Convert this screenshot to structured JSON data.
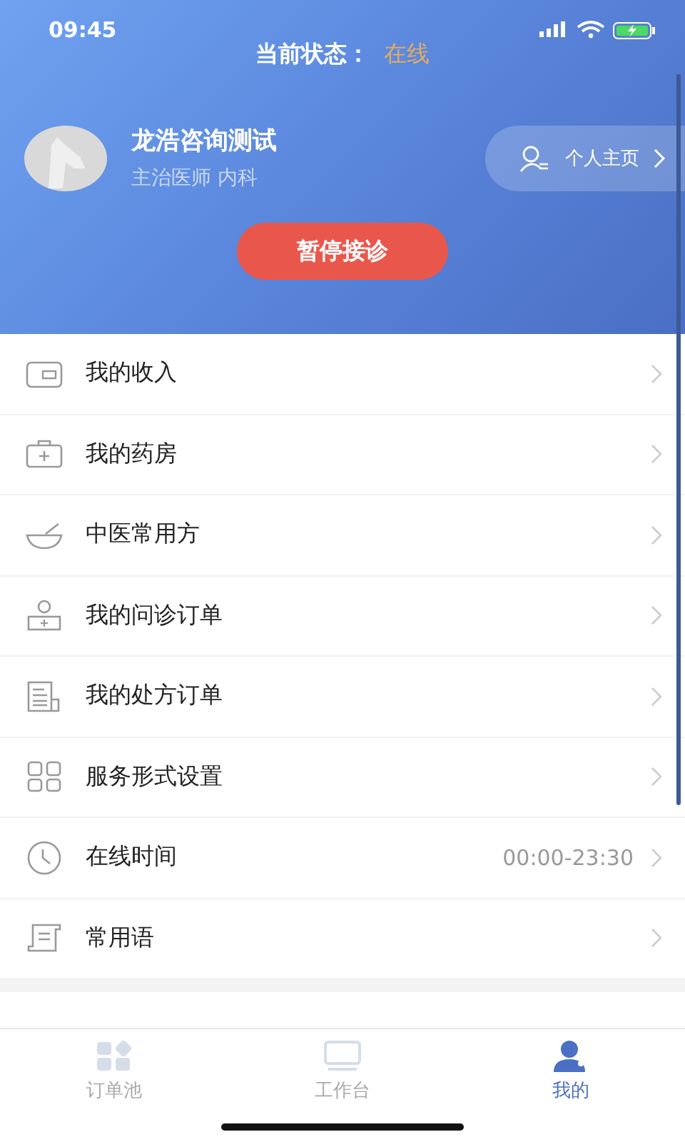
{
  "status_bar": {
    "time": "09:45"
  },
  "header": {
    "status_label": "当前状态：",
    "status_value": "在线"
  },
  "profile": {
    "name": "龙浩咨询测试",
    "subtitle": "主治医师 内科",
    "homepage_link": "个人主页",
    "pause_button": "暂停接诊"
  },
  "menu": [
    {
      "label": "我的收入"
    },
    {
      "label": "我的药房"
    },
    {
      "label": "中医常用方"
    },
    {
      "label": "我的问诊订单"
    },
    {
      "label": "我的处方订单"
    },
    {
      "label": "服务形式设置"
    },
    {
      "label": "在线时间",
      "value": "00:00-23:30"
    },
    {
      "label": "常用语"
    }
  ],
  "tabs": [
    {
      "label": "订单池",
      "selected": false
    },
    {
      "label": "工作台",
      "selected": false
    },
    {
      "label": "我的",
      "selected": true
    }
  ]
}
